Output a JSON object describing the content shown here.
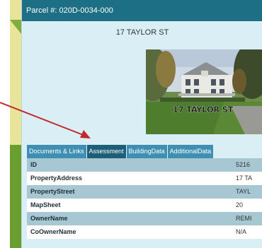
{
  "popup": {
    "header": "Parcel #: 020D-0034-000",
    "address": "17 TAYLOR ST",
    "photo_caption": "17 TAYLOR ST"
  },
  "tabs": [
    {
      "label": "Documents & Links",
      "active": false
    },
    {
      "label": "Assessment",
      "active": true
    },
    {
      "label": "BuildingData",
      "active": false
    },
    {
      "label": "AdditionalData",
      "active": false
    }
  ],
  "rows": [
    {
      "key": "ID",
      "value": "5216"
    },
    {
      "key": "PropertyAddress",
      "value": "17 TA"
    },
    {
      "key": "PropertyStreet",
      "value": "TAYL"
    },
    {
      "key": "MapSheet",
      "value": "20"
    },
    {
      "key": "OwnerName",
      "value": "REMI"
    },
    {
      "key": "CoOwnerName",
      "value": "N/A"
    }
  ],
  "colors": {
    "header": "#1d6f86",
    "tab": "#3f8fb3",
    "tab_active": "#1d5f79",
    "row_shade": "#a7c7d3",
    "arrow": "#c0282d"
  }
}
